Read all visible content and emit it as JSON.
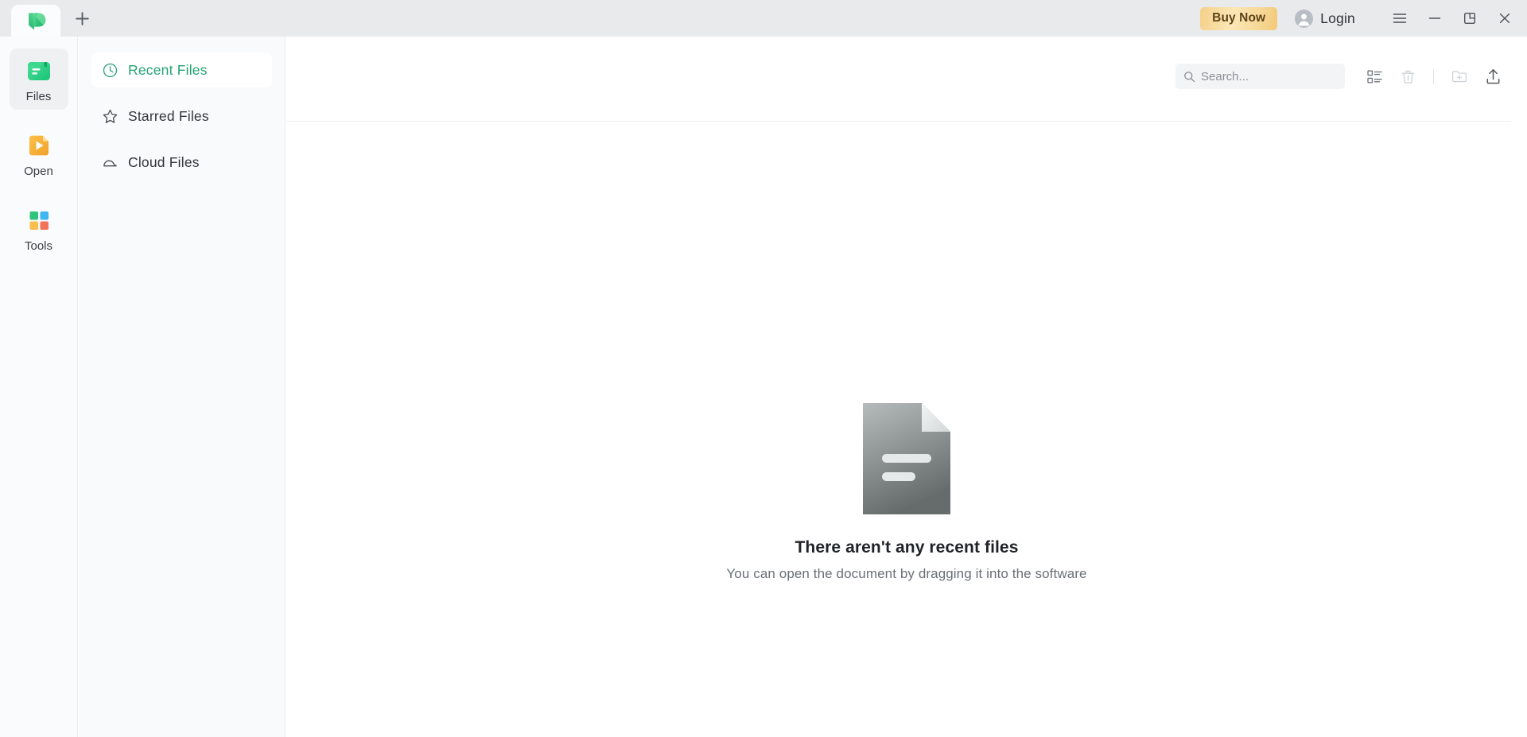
{
  "titlebar": {
    "tab": {
      "name": "app-tab",
      "logo_icon": "app-logo-icon"
    },
    "new_tab_label": "+",
    "buy_now_label": "Buy Now",
    "login_label": "Login",
    "avatar_icon": "avatar-icon",
    "menu_icon": "hamburger-menu-icon",
    "minimize_icon": "minimize-icon",
    "maximize_icon": "maximize-restore-icon",
    "close_icon": "close-icon"
  },
  "rail": {
    "items": [
      {
        "label": "Files",
        "icon": "files-icon",
        "active": true
      },
      {
        "label": "Open",
        "icon": "open-play-icon",
        "active": false
      },
      {
        "label": "Tools",
        "icon": "tools-grid-icon",
        "active": false
      }
    ]
  },
  "nav": {
    "items": [
      {
        "label": "Recent Files",
        "icon": "clock-icon",
        "active": true
      },
      {
        "label": "Starred Files",
        "icon": "star-icon",
        "active": false
      },
      {
        "label": "Cloud Files",
        "icon": "cloud-icon",
        "active": false
      }
    ]
  },
  "toolbar": {
    "search_placeholder": "Search...",
    "search_value": "",
    "search_icon": "search-icon",
    "list_view_icon": "list-view-icon",
    "trash_icon": "trash-icon",
    "new_folder_icon": "new-folder-icon",
    "upload_icon": "upload-share-icon"
  },
  "empty_state": {
    "icon": "document-page-icon",
    "title": "There aren't any recent files",
    "subtitle": "You can open the document by dragging it into the software"
  },
  "colors": {
    "brand_green": "#24a474",
    "buy_now_gold": "#f3c876",
    "titlebar_bg": "#e8eaec",
    "panel_bg": "#f8fafc"
  }
}
